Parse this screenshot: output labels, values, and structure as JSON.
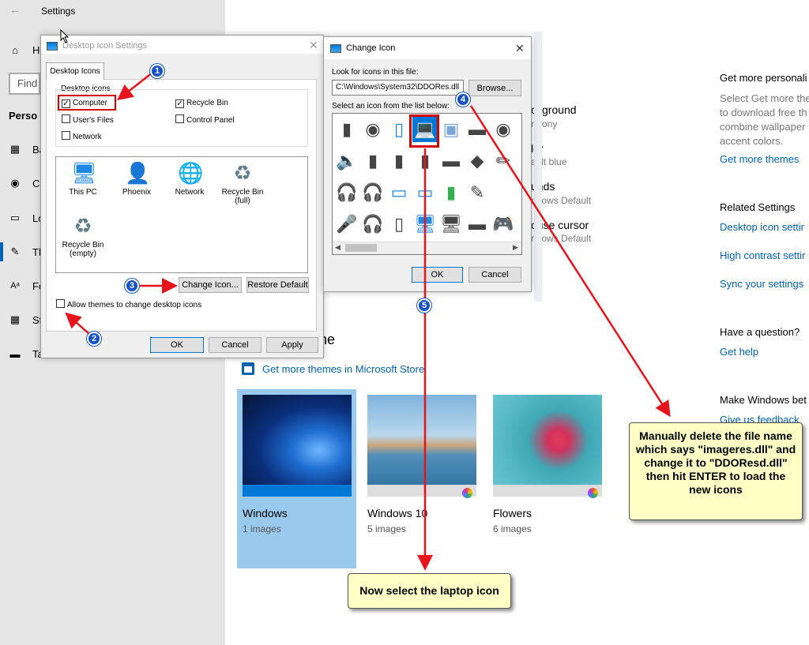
{
  "settings": {
    "title": "Settings",
    "sidebar": {
      "home_prefix": "H",
      "find_prefix": "Find",
      "section_prefix": "Perso",
      "items": [
        {
          "prefix": "Ba"
        },
        {
          "prefix": "Co"
        },
        {
          "prefix": "Lo"
        },
        {
          "prefix": "Th"
        },
        {
          "prefix": "Fo"
        },
        {
          "prefix": "St"
        },
        {
          "prefix": "Ta"
        }
      ]
    },
    "themes_partial": {
      "background_label": "ckground",
      "background_value": "rmony",
      "color_label": "lor",
      "color_value": "ault blue",
      "sounds_label": "unds",
      "sounds_value": "ndows Default",
      "cursor_label": "ouse cursor",
      "cursor_value": "ndows Default",
      "heading_tail": "ne"
    },
    "store_link": "Get more themes in Microsoft Store",
    "themes": [
      {
        "name": "Windows",
        "count": "1 images"
      },
      {
        "name": "Windows 10",
        "count": "5 images"
      },
      {
        "name": "Flowers",
        "count": "6 images"
      }
    ],
    "right_panel": {
      "get_more_heading": "Get more personali",
      "get_more_desc": [
        "Select Get more the",
        "to download free th",
        "combine wallpaper",
        "accent colors."
      ],
      "get_more_link": "Get more themes",
      "related_heading": "Related Settings",
      "related_links": [
        "Desktop icon settir",
        "High contrast settir",
        "Sync your settings"
      ],
      "question_heading": "Have a question?",
      "help_link": "Get help",
      "better_heading": "Make Windows bet",
      "feedback_link": "Give us feedback"
    }
  },
  "desktop_icon_dialog": {
    "title": "Desktop Icon Settings",
    "tab": "Desktop Icons",
    "group_label": "Desktop icons",
    "checkboxes": [
      {
        "label": "Computer",
        "checked": true
      },
      {
        "label": "Recycle Bin",
        "checked": true
      },
      {
        "label": "User's Files",
        "checked": false
      },
      {
        "label": "Control Panel",
        "checked": false
      },
      {
        "label": "Network",
        "checked": false
      }
    ],
    "icons": [
      {
        "label": "This PC"
      },
      {
        "label": "Phoenix"
      },
      {
        "label": "Network"
      },
      {
        "label": "Recycle Bin (full)"
      },
      {
        "label": "Recycle Bin (empty)"
      }
    ],
    "change_icon_button": "Change Icon...",
    "restore_default_button": "Restore Default",
    "allow_themes_label": "Allow themes to change desktop icons",
    "ok_button": "OK",
    "cancel_button": "Cancel",
    "apply_button": "Apply"
  },
  "change_icon_dialog": {
    "title": "Change Icon",
    "look_for_label": "Look for icons in this file:",
    "file_path": "C:\\Windows\\System32\\DDORes.dll",
    "browse_button": "Browse...",
    "select_label": "Select an icon from the list below:",
    "ok_button": "OK",
    "cancel_button": "Cancel",
    "icon_grid": [
      [
        "tower",
        "speaker-box",
        "phone",
        "laptop",
        "picture-frame",
        "projector",
        "webcam"
      ],
      [
        "speaker",
        "speaker-tall",
        "pc-tower",
        "pc-tower-dark",
        "router",
        "disk",
        "pen"
      ],
      [
        "headphones",
        "headset",
        "tablet",
        "tablet-angled",
        "battery",
        "drawing-pad",
        ""
      ],
      [
        "microphone",
        "headset-stand",
        "phone-small",
        "monitor-small",
        "monitor",
        "hub",
        "gamepad"
      ]
    ]
  },
  "annotations": {
    "badges": [
      "1",
      "2",
      "3",
      "4",
      "5"
    ],
    "callout_delete": "Manually delete the file name which says \"imageres.dll\" and change it to \"DDOResd.dll\" then hit ENTER to load the new icons",
    "callout_laptop": "Now select the laptop icon"
  },
  "colors": {
    "accent": "#0063b1",
    "arrow": "#e8141b",
    "badge": "#1452c5",
    "callout_bg": "#ffffc6",
    "highlight_box": "#d40000"
  }
}
